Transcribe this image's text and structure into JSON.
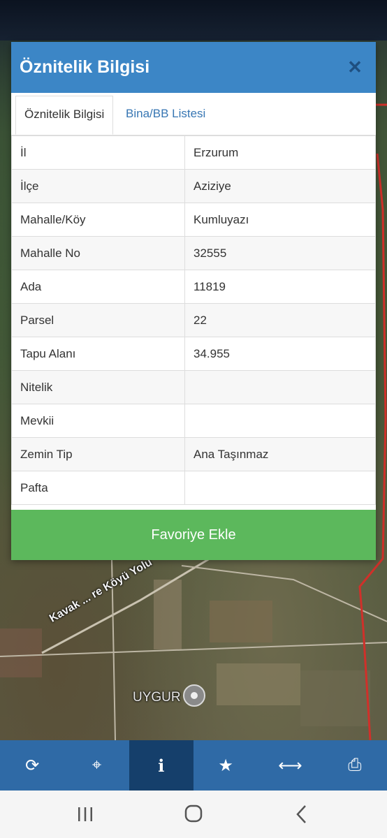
{
  "modal": {
    "title": "Öznitelik Bilgisi",
    "close_label": "✕",
    "tabs": [
      {
        "label": "Öznitelik Bilgisi"
      },
      {
        "label": "Bina/BB Listesi"
      }
    ],
    "rows": [
      {
        "key": "İl",
        "value": "Erzurum"
      },
      {
        "key": "İlçe",
        "value": "Aziziye"
      },
      {
        "key": "Mahalle/Köy",
        "value": "Kumluyazı"
      },
      {
        "key": "Mahalle No",
        "value": "32555"
      },
      {
        "key": "Ada",
        "value": "11819"
      },
      {
        "key": "Parsel",
        "value": "22"
      },
      {
        "key": "Tapu Alanı",
        "value": "34.955"
      },
      {
        "key": "Nitelik",
        "value": ""
      },
      {
        "key": "Mevkii",
        "value": ""
      },
      {
        "key": "Zemin Tip",
        "value": "Ana Taşınmaz"
      },
      {
        "key": "Pafta",
        "value": ""
      }
    ],
    "favorite_label": "Favoriye Ekle"
  },
  "map": {
    "place_label": "UYGUR",
    "road_label": "Kavak ... re Köyü Yolu"
  },
  "toolbar": {
    "items": [
      {
        "icon": "refresh-icon",
        "glyph": "⟳"
      },
      {
        "icon": "locate-icon",
        "glyph": "⌖"
      },
      {
        "icon": "info-icon",
        "glyph": "i"
      },
      {
        "icon": "star-icon",
        "glyph": "★"
      },
      {
        "icon": "measure-icon",
        "glyph": "⟷"
      },
      {
        "icon": "print-icon",
        "glyph": "⎙"
      }
    ]
  },
  "colors": {
    "header": "#3c86c6",
    "favorite": "#5cb85c",
    "toolbar": "#2f6aa6",
    "toolbar_active": "#153f6b"
  }
}
